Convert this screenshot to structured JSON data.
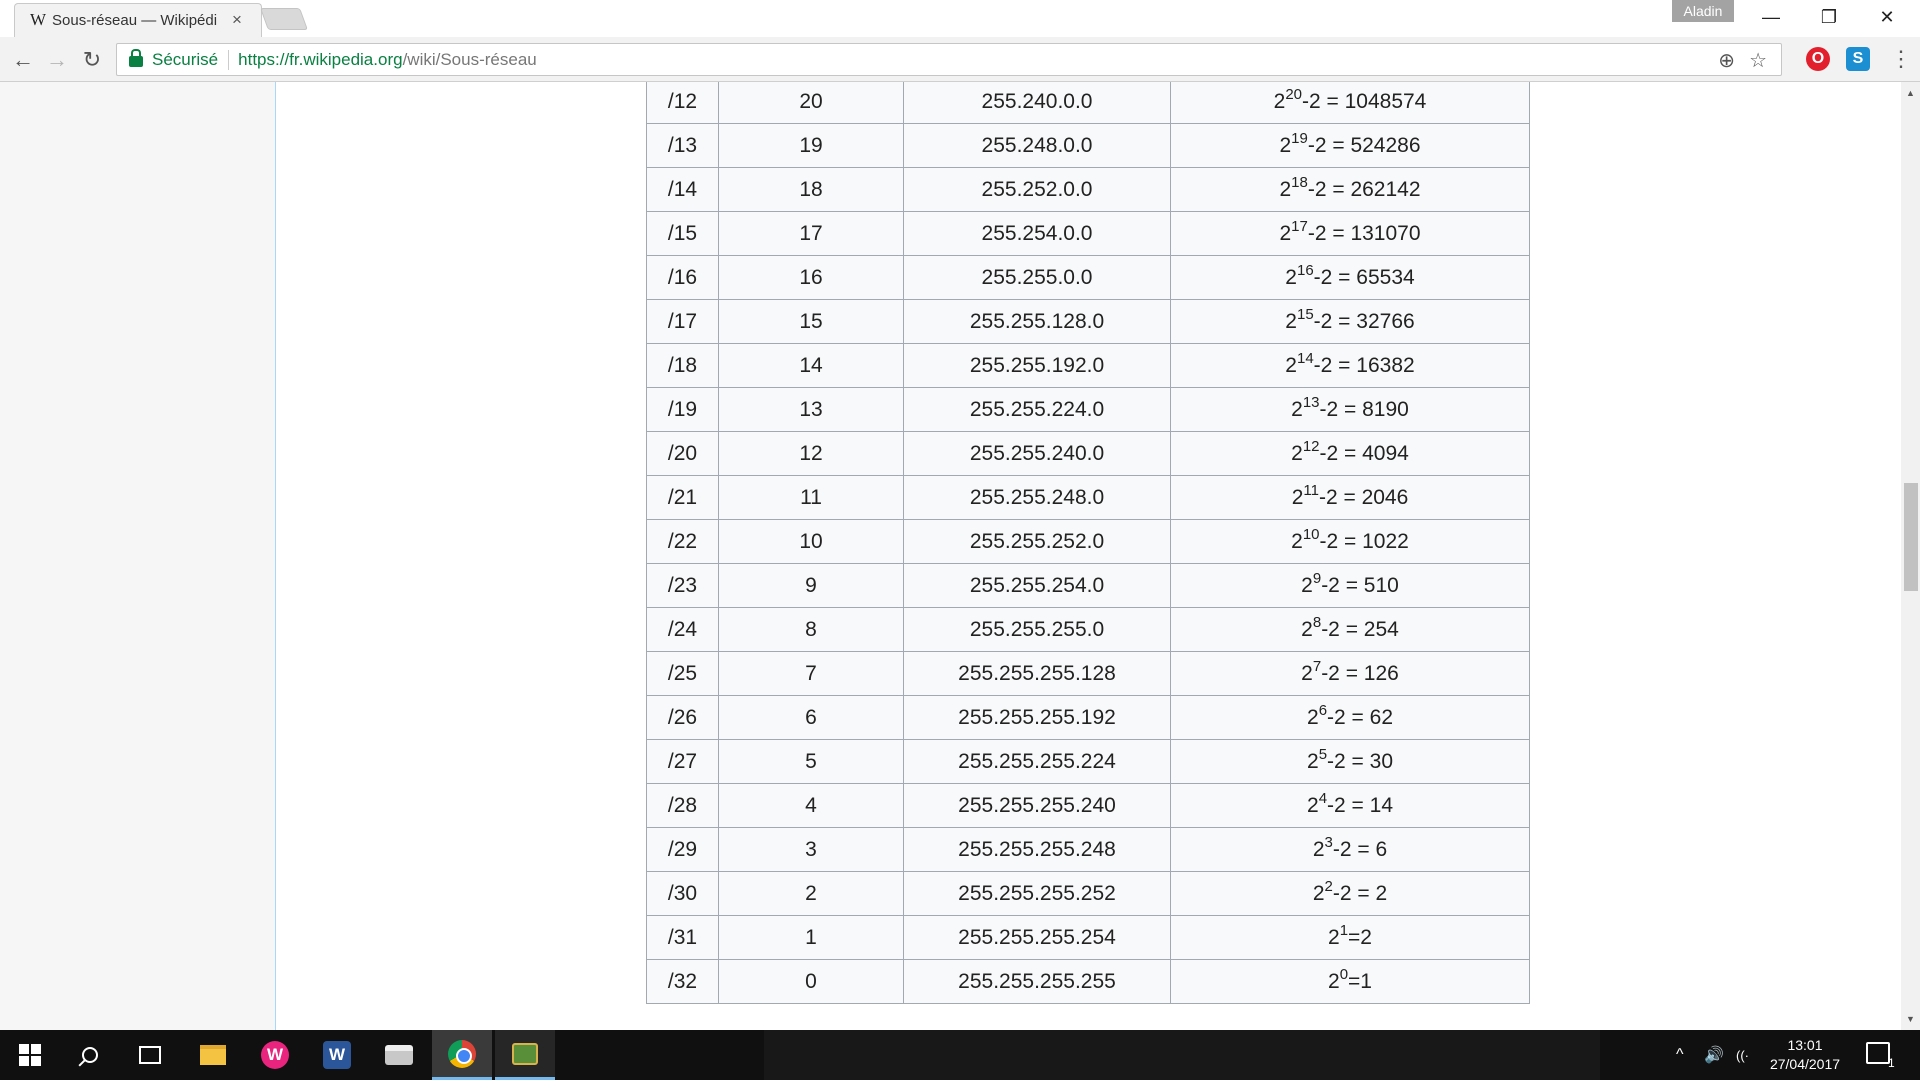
{
  "browser": {
    "tab": {
      "favicon": "W",
      "title": "Sous-réseau — Wikipédi",
      "close": "×"
    },
    "profile_name": "Aladin",
    "window_controls": {
      "minimize": "—",
      "restore": "❐",
      "close": "✕"
    },
    "nav": {
      "back": "←",
      "forward": "→",
      "reload": "↻"
    },
    "address": {
      "security_label": "Sécurisé",
      "url_host": "https://fr.wikipedia.org",
      "url_path": "/wiki/Sous-réseau"
    },
    "omnibox_icons": {
      "zoom": "⊕",
      "bookmark": "☆"
    },
    "extensions": [
      {
        "name": "opera-extension",
        "glyph": "O",
        "color": "#e2202d"
      },
      {
        "name": "skype-extension",
        "glyph": "S",
        "color": "#1b8fd2"
      }
    ],
    "menu": "⋮"
  },
  "table": {
    "rows": [
      {
        "prefix": "/12",
        "bits": "20",
        "mask": "255.240.0.0",
        "base": "2",
        "exp": "20",
        "tail": "-2 = 1048574"
      },
      {
        "prefix": "/13",
        "bits": "19",
        "mask": "255.248.0.0",
        "base": "2",
        "exp": "19",
        "tail": "-2 = 524286"
      },
      {
        "prefix": "/14",
        "bits": "18",
        "mask": "255.252.0.0",
        "base": "2",
        "exp": "18",
        "tail": "-2 = 262142"
      },
      {
        "prefix": "/15",
        "bits": "17",
        "mask": "255.254.0.0",
        "base": "2",
        "exp": "17",
        "tail": "-2 = 131070"
      },
      {
        "prefix": "/16",
        "bits": "16",
        "mask": "255.255.0.0",
        "base": "2",
        "exp": "16",
        "tail": "-2 = 65534"
      },
      {
        "prefix": "/17",
        "bits": "15",
        "mask": "255.255.128.0",
        "base": "2",
        "exp": "15",
        "tail": "-2 = 32766"
      },
      {
        "prefix": "/18",
        "bits": "14",
        "mask": "255.255.192.0",
        "base": "2",
        "exp": "14",
        "tail": "-2 = 16382"
      },
      {
        "prefix": "/19",
        "bits": "13",
        "mask": "255.255.224.0",
        "base": "2",
        "exp": "13",
        "tail": "-2 = 8190"
      },
      {
        "prefix": "/20",
        "bits": "12",
        "mask": "255.255.240.0",
        "base": "2",
        "exp": "12",
        "tail": "-2 = 4094"
      },
      {
        "prefix": "/21",
        "bits": "11",
        "mask": "255.255.248.0",
        "base": "2",
        "exp": "11",
        "tail": "-2 = 2046"
      },
      {
        "prefix": "/22",
        "bits": "10",
        "mask": "255.255.252.0",
        "base": "2",
        "exp": "10",
        "tail": "-2 = 1022"
      },
      {
        "prefix": "/23",
        "bits": "9",
        "mask": "255.255.254.0",
        "base": "2",
        "exp": "9",
        "tail": "-2 = 510"
      },
      {
        "prefix": "/24",
        "bits": "8",
        "mask": "255.255.255.0",
        "base": "2",
        "exp": "8",
        "tail": "-2 = 254"
      },
      {
        "prefix": "/25",
        "bits": "7",
        "mask": "255.255.255.128",
        "base": "2",
        "exp": "7",
        "tail": "-2 = 126"
      },
      {
        "prefix": "/26",
        "bits": "6",
        "mask": "255.255.255.192",
        "base": "2",
        "exp": "6",
        "tail": "-2 = 62"
      },
      {
        "prefix": "/27",
        "bits": "5",
        "mask": "255.255.255.224",
        "base": "2",
        "exp": "5",
        "tail": "-2 = 30"
      },
      {
        "prefix": "/28",
        "bits": "4",
        "mask": "255.255.255.240",
        "base": "2",
        "exp": "4",
        "tail": "-2 = 14"
      },
      {
        "prefix": "/29",
        "bits": "3",
        "mask": "255.255.255.248",
        "base": "2",
        "exp": "3",
        "tail": "-2 = 6"
      },
      {
        "prefix": "/30",
        "bits": "2",
        "mask": "255.255.255.252",
        "base": "2",
        "exp": "2",
        "tail": "-2 = 2"
      },
      {
        "prefix": "/31",
        "bits": "1",
        "mask": "255.255.255.254",
        "base": "2",
        "exp": "1",
        "tail": "=2"
      },
      {
        "prefix": "/32",
        "bits": "0",
        "mask": "255.255.255.255",
        "base": "2",
        "exp": "0",
        "tail": "=1"
      }
    ]
  },
  "taskbar": {
    "apps": [
      {
        "name": "start-button",
        "icon": "windows-logo-icon"
      },
      {
        "name": "search-button",
        "icon": "search-icon"
      },
      {
        "name": "task-view-button",
        "icon": "task-view-icon"
      },
      {
        "name": "file-explorer",
        "icon": "folder-icon"
      },
      {
        "name": "wamp-app",
        "icon": "w-icon",
        "glyph": "W",
        "color": "#e8247e"
      },
      {
        "name": "word-app",
        "icon": "word-icon",
        "glyph": "W",
        "color": "#2b579a"
      },
      {
        "name": "printer-app",
        "icon": "printer-icon"
      },
      {
        "name": "chrome-app",
        "icon": "chrome-icon"
      },
      {
        "name": "network-app",
        "icon": "network-tool-icon"
      }
    ],
    "tray": {
      "chevron": "^",
      "volume": "🔊",
      "wifi": "((·"
    },
    "clock": {
      "time": "13:01",
      "date": "27/04/2017"
    },
    "notifications_count": "1"
  }
}
